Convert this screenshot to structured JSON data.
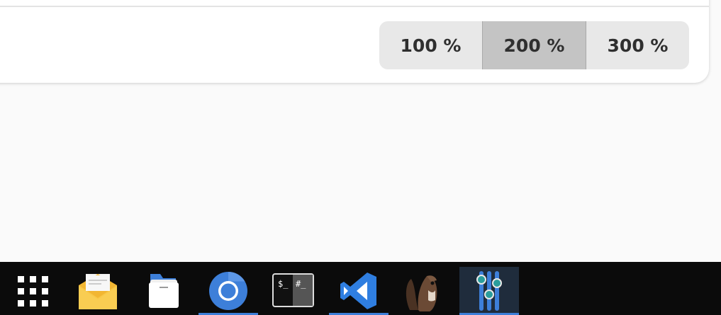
{
  "zoom": {
    "options": [
      "100 %",
      "200 %",
      "300 %"
    ],
    "selected": "200 %"
  },
  "taskbar": {
    "items": [
      {
        "name": "app-grid-icon",
        "running": false,
        "focused": false
      },
      {
        "name": "mail-icon",
        "running": false,
        "focused": false
      },
      {
        "name": "files-icon",
        "running": false,
        "focused": false
      },
      {
        "name": "chromium-icon",
        "running": true,
        "focused": false
      },
      {
        "name": "terminal-icon",
        "running": false,
        "focused": false
      },
      {
        "name": "vscode-icon",
        "running": true,
        "focused": false
      },
      {
        "name": "beaver-icon",
        "running": false,
        "focused": false
      },
      {
        "name": "settings-sliders-icon",
        "running": true,
        "focused": true
      }
    ],
    "terminal_glyphs": {
      "left": "$_",
      "right": "#_"
    }
  },
  "colors": {
    "accent": "#3d7fd9",
    "taskbar_bg": "#0b0b0b",
    "selected_segment": "#c4c4c4",
    "segment_bg": "#e8e8e8"
  }
}
